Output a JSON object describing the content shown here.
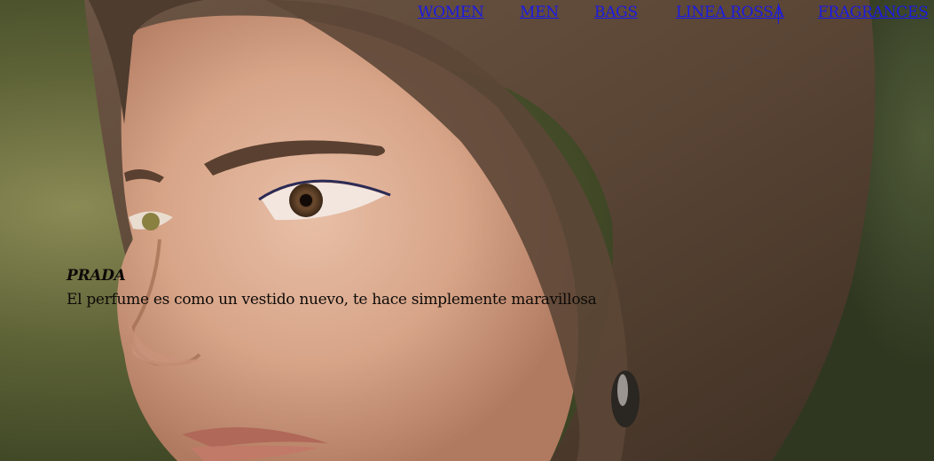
{
  "nav": {
    "items": [
      {
        "label": "WOMEN"
      },
      {
        "label": "MEN"
      },
      {
        "label": "BAGS"
      },
      {
        "label": "LINEA ROSSA"
      },
      {
        "label": "FRAGRANCES"
      }
    ]
  },
  "hero": {
    "image": "woman-portrait-closeup",
    "brand": "PRADA",
    "quote": "El perfume es como un vestido nuevo, te hace simplemente maravillosa"
  },
  "colors": {
    "link": "#1a1ae6",
    "caption_text": "#0d0a08"
  }
}
